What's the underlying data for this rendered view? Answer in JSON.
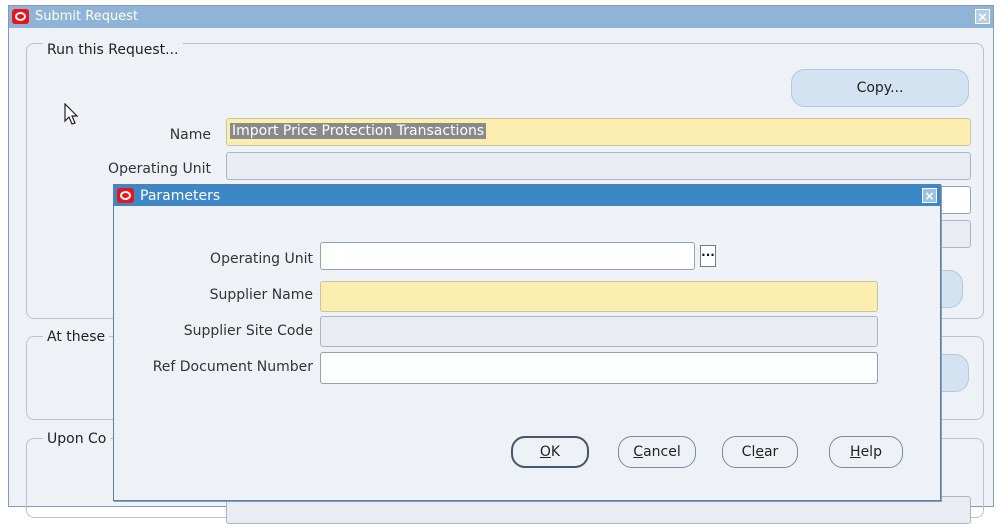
{
  "main_window": {
    "title": "Submit Request",
    "close_glyph": "×",
    "run_group_title": "Run this Request...",
    "copy_button": "Copy...",
    "name_label": "Name",
    "name_value": "Import Price Protection Transactions",
    "operating_unit_label": "Operating Unit",
    "at_these_title": "At these",
    "upon_title": "Upon Co"
  },
  "dialog": {
    "title": "Parameters",
    "close_glyph": "×",
    "lov_glyph": "...",
    "fields": {
      "operating_unit": {
        "label": "Operating Unit",
        "value": ""
      },
      "supplier_name": {
        "label": "Supplier Name",
        "value": ""
      },
      "supplier_site_code": {
        "label": "Supplier Site Code",
        "value": ""
      },
      "ref_document_number": {
        "label": "Ref Document Number",
        "value": ""
      }
    },
    "buttons": {
      "ok": {
        "key": "O",
        "rest": "K"
      },
      "cancel": {
        "key": "C",
        "rest": "ancel"
      },
      "clear": {
        "pre": "Cl",
        "key": "e",
        "rest": "ar"
      },
      "help": {
        "key": "H",
        "rest": "elp"
      }
    }
  },
  "colors": {
    "required_field": "#fbeeb0",
    "dialog_titlebar": "#3d87c7",
    "main_titlebar": "#8fb4d8"
  },
  "icons": {
    "oracle_logo": "oracle-logo-icon",
    "mouse_pointer": "mouse-pointer-icon",
    "close": "close-icon",
    "list_of_values": "ellipsis-icon"
  }
}
